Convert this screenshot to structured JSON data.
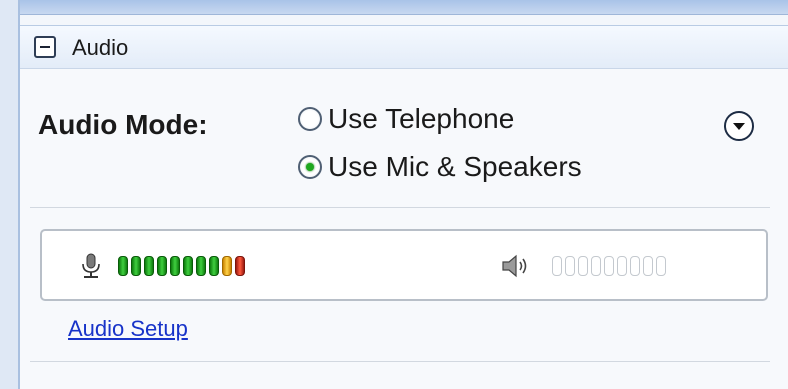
{
  "header": {
    "title": "Audio"
  },
  "audio_mode": {
    "label": "Audio Mode:",
    "options": [
      {
        "label": "Use Telephone",
        "selected": false
      },
      {
        "label": "Use Mic & Speakers",
        "selected": true
      }
    ]
  },
  "meters": {
    "microphone": {
      "icon": "microphone-icon",
      "segments": [
        "green",
        "green",
        "green",
        "green",
        "green",
        "green",
        "green",
        "green",
        "yellow",
        "red"
      ]
    },
    "speaker": {
      "icon": "speaker-icon",
      "segments": [
        "off",
        "off",
        "off",
        "off",
        "off",
        "off",
        "off",
        "off",
        "off"
      ]
    }
  },
  "links": {
    "audio_setup": "Audio Setup"
  },
  "colors": {
    "link": "#1733c9",
    "radio_selected": "#1fa81f",
    "header_bg": "#e3ecf8"
  }
}
